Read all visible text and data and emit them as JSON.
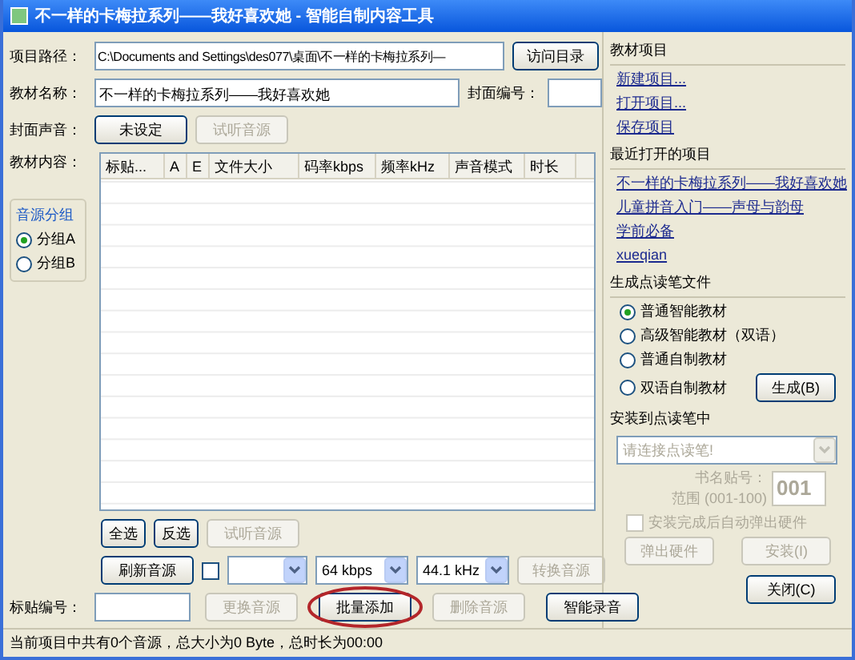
{
  "window": {
    "title": "不一样的卡梅拉系列——我好喜欢她 - 智能自制内容工具"
  },
  "path": {
    "label": "项目路径：",
    "value": "C:\\Documents and Settings\\des077\\桌面\\不一样的卡梅拉系列—",
    "button": "访问目录"
  },
  "name": {
    "label": "教材名称：",
    "value": "不一样的卡梅拉系列——我好喜欢她",
    "cover_label": "封面编号："
  },
  "cover_sound": {
    "label": "封面声音：",
    "buttons": [
      {
        "label": "未设定",
        "disabled": false
      },
      {
        "label": "试听音源",
        "disabled": true
      }
    ]
  },
  "content_label": "教材内容：",
  "group": {
    "title": "音源分组",
    "options": [
      {
        "label": "分组A",
        "selected": true
      },
      {
        "label": "分组B",
        "selected": false
      }
    ]
  },
  "table": {
    "columns": [
      "标贴...",
      "A",
      "E",
      "文件大小",
      "码率kbps",
      "频率kHz",
      "声音模式",
      "时长"
    ]
  },
  "select_buttons": [
    {
      "label": "全选",
      "disabled": false
    },
    {
      "label": "反选",
      "disabled": false
    },
    {
      "label": "试听音源",
      "disabled": true
    }
  ],
  "convert": {
    "refresh": "刷新音源",
    "checked": false,
    "bitrate": "64 kbps",
    "frequency": "44.1 kHz",
    "button": {
      "label": "转换音源",
      "disabled": true
    }
  },
  "sticker": {
    "label": "标贴编号：",
    "buttons": [
      {
        "label": "更换音源",
        "disabled": true,
        "circled": false
      },
      {
        "label": "批量添加",
        "disabled": false,
        "circled": true
      },
      {
        "label": "删除音源",
        "disabled": true,
        "circled": false
      },
      {
        "label": "智能录音",
        "disabled": false,
        "circled": false
      }
    ]
  },
  "status_bar": "当前项目中共有0个音源，总大小为0 Byte，总时长为00:00",
  "sidebar": {
    "project": {
      "title": "教材项目",
      "links": [
        "新建项目...",
        "打开项目...",
        "保存项目"
      ]
    },
    "recent": {
      "title": "最近打开的项目",
      "links": [
        "不一样的卡梅拉系列——我好喜欢她",
        "儿童拼音入门——声母与韵母",
        "学前必备",
        "xueqian"
      ]
    },
    "generate": {
      "title": "生成点读笔文件",
      "options": [
        {
          "label": "普通智能教材",
          "selected": true
        },
        {
          "label": "高级智能教材（双语）",
          "selected": false
        },
        {
          "label": "普通自制教材",
          "selected": false
        },
        {
          "label": "双语自制教材",
          "selected": false
        }
      ],
      "button": "生成(B)"
    },
    "install": {
      "title": "安装到点读笔中",
      "pen": {
        "value": "请连接点读笔!",
        "disabled": true
      },
      "book_label": "书名贴号：",
      "range": "范围 (001-100)",
      "number": "001",
      "auto_eject": {
        "label": "安装完成后自动弹出硬件",
        "checked": false,
        "disabled": true
      },
      "buttons": [
        {
          "label": "弹出硬件",
          "disabled": true
        },
        {
          "label": "安装(I)",
          "disabled": true
        }
      ]
    },
    "close": "关闭(C)"
  }
}
